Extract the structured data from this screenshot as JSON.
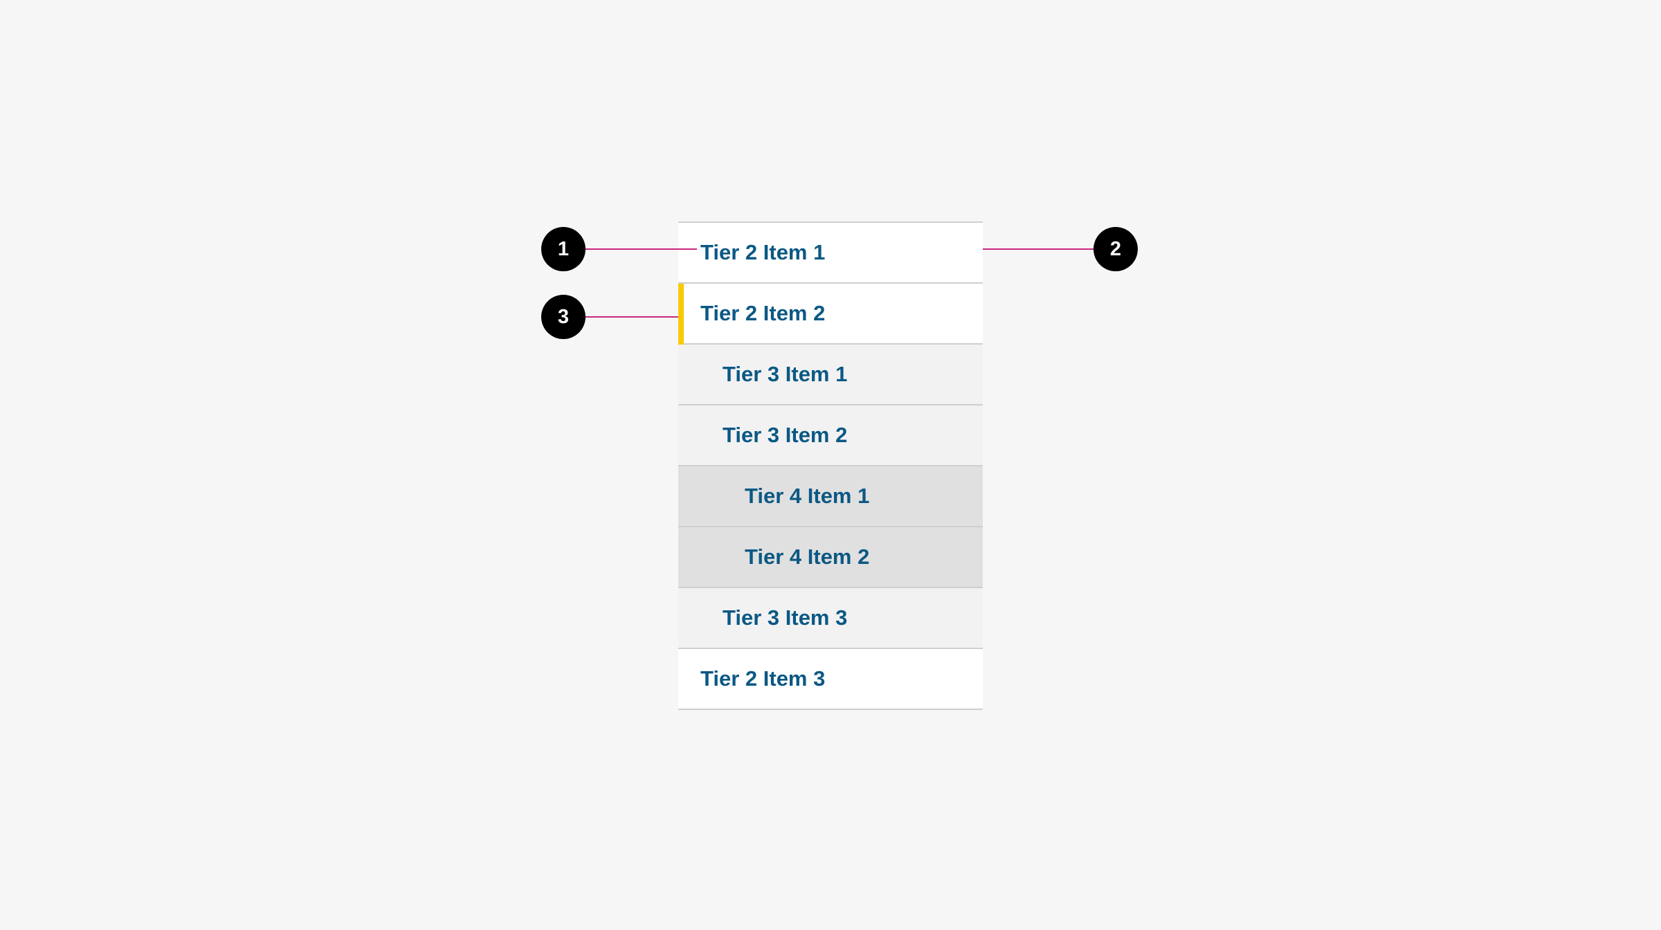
{
  "menu": {
    "items": [
      {
        "label": "Tier 2 Item 1",
        "tier": 2,
        "active": false
      },
      {
        "label": "Tier 2 Item 2",
        "tier": 2,
        "active": true
      },
      {
        "label": "Tier 3 Item 1",
        "tier": 3,
        "active": false
      },
      {
        "label": "Tier 3 Item 2",
        "tier": 3,
        "active": false
      },
      {
        "label": "Tier 4 Item 1",
        "tier": 4,
        "active": false
      },
      {
        "label": "Tier 4 Item 2",
        "tier": 4,
        "active": false
      },
      {
        "label": "Tier 3 Item 3",
        "tier": 3,
        "active": false
      },
      {
        "label": "Tier 2 Item 3",
        "tier": 2,
        "active": false
      }
    ]
  },
  "annotations": {
    "markers": [
      {
        "number": "1"
      },
      {
        "number": "2"
      },
      {
        "number": "3"
      }
    ]
  },
  "colors": {
    "link_text": "#0b5884",
    "active_indicator": "#f9cb07",
    "leader_line": "#c8267f",
    "tier2_bg": "#ffffff",
    "tier3_bg": "#f2f2f2",
    "tier4_bg": "#e0e0e0"
  }
}
